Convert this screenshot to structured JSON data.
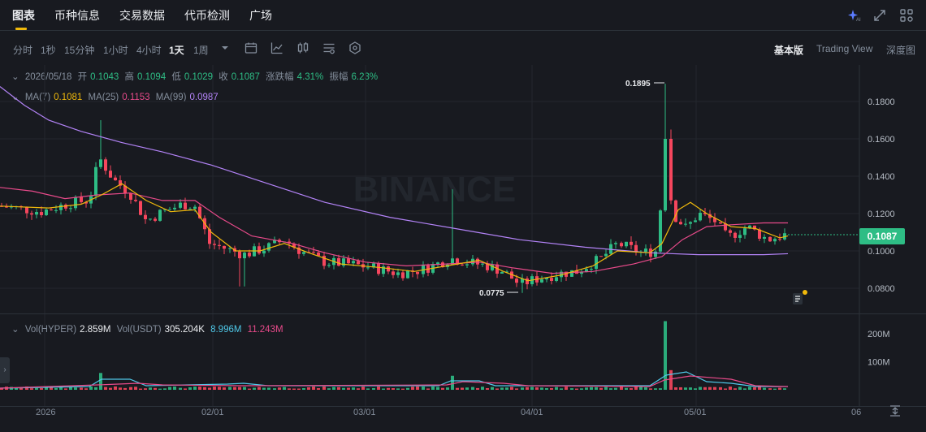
{
  "tabs": [
    {
      "label": "图表",
      "active": true
    },
    {
      "label": "币种信息"
    },
    {
      "label": "交易数据"
    },
    {
      "label": "代币检测"
    },
    {
      "label": "广场"
    }
  ],
  "top_icons": [
    "ai-sparkle-icon",
    "expand-icon",
    "grid-settings-icon"
  ],
  "timeframes": [
    {
      "label": "分时"
    },
    {
      "label": "1秒"
    },
    {
      "label": "15分钟"
    },
    {
      "label": "1小时"
    },
    {
      "label": "4小时"
    },
    {
      "label": "1天",
      "active": true
    },
    {
      "label": "1周"
    }
  ],
  "tools": [
    "more-dropdown-icon",
    "candle-style-icon",
    "indicator-icon",
    "candle-type-icon",
    "settings-icon",
    "hexagon-icon"
  ],
  "views": [
    {
      "label": "基本版",
      "active": true
    },
    {
      "label": "Trading View"
    },
    {
      "label": "深度图"
    }
  ],
  "ohlc": {
    "date": "2026/05/18",
    "open_label": "开",
    "open": "0.1043",
    "high_label": "高",
    "high": "0.1094",
    "low_label": "低",
    "low": "0.1029",
    "close_label": "收",
    "close": "0.1087",
    "chg_label": "涨跌幅",
    "chg": "4.31%",
    "amp_label": "振幅",
    "amp": "6.23%"
  },
  "ma": {
    "ma7_label": "MA(7)",
    "ma7": "0.1081",
    "ma25_label": "MA(25)",
    "ma25": "0.1153",
    "ma99_label": "MA(99)",
    "ma99": "0.0987"
  },
  "price_axis": [
    "0.1800",
    "0.1600",
    "0.1400",
    "0.1200",
    "0.1000",
    "0.0800"
  ],
  "current_price": "0.1087",
  "high_marker": "0.1895",
  "low_marker": "0.0775",
  "watermark": "BINANCE",
  "volume": {
    "vol_label": "Vol(HYPER)",
    "vol": "2.859M",
    "vol_usdt_label": "Vol(USDT)",
    "vol_usdt": "305.204K",
    "ma5": "8.996M",
    "ma10": "11.243M",
    "axis": [
      "200M",
      "100M"
    ]
  },
  "x_axis": [
    "2026",
    "02/01",
    "03/01",
    "04/01",
    "05/01",
    "06"
  ],
  "colors": {
    "up": "#2ebd85",
    "down": "#f6465d",
    "ma7": "#f0b90b",
    "ma25": "#e84a8a",
    "ma99": "#b383f7",
    "accent": "#f0b90b"
  }
}
